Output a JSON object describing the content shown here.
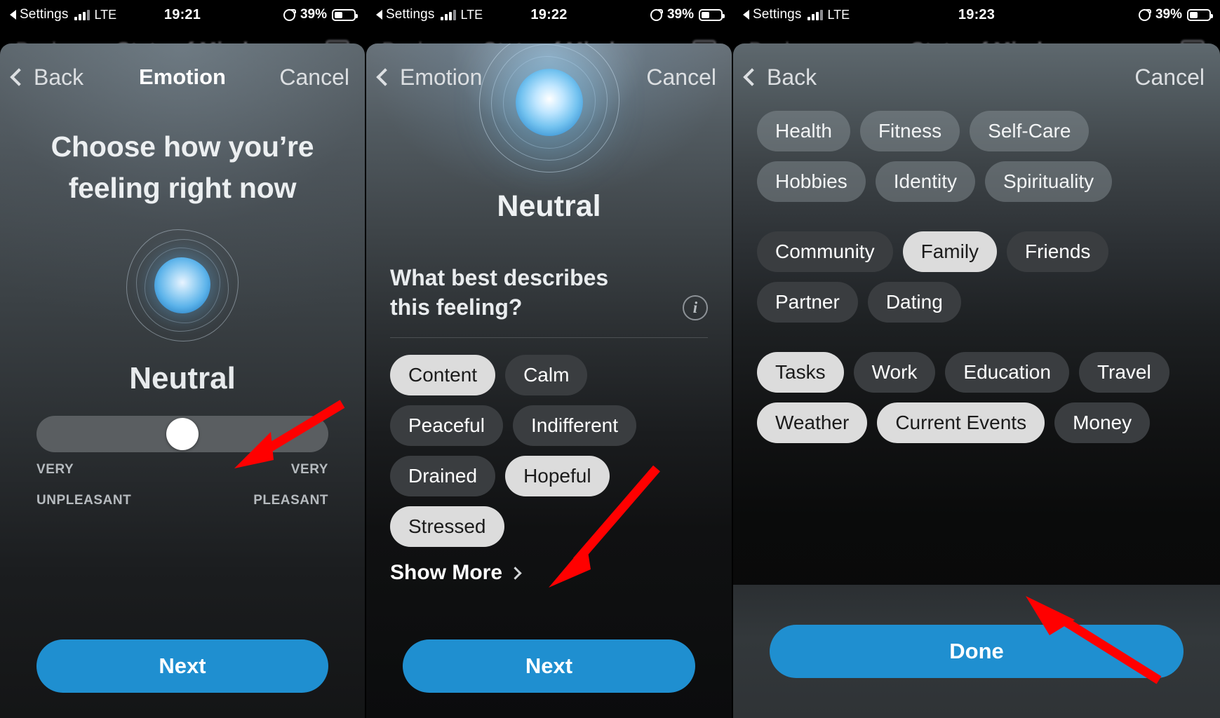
{
  "status_bars": [
    {
      "carrier": "Settings",
      "network": "LTE",
      "time": "19:21",
      "battery_pct": "39%"
    },
    {
      "carrier": "Settings",
      "network": "LTE",
      "time": "19:22",
      "battery_pct": "39%"
    },
    {
      "carrier": "Settings",
      "network": "LTE",
      "time": "19:23",
      "battery_pct": "39%"
    }
  ],
  "underlying_screen": {
    "back_label": "Back",
    "title": "State of Mind"
  },
  "panel1": {
    "nav": {
      "back_label": "Back",
      "title": "Emotion",
      "cancel_label": "Cancel"
    },
    "heading": "Choose how you’re feeling right now",
    "emotion": "Neutral",
    "slider": {
      "left_label_line1": "VERY",
      "left_label_line2": "UNPLEASANT",
      "right_label_line1": "VERY",
      "right_label_line2": "PLEASANT",
      "value_pct": 50
    },
    "cta_label": "Next"
  },
  "panel2": {
    "nav": {
      "back_label": "Emotion",
      "title": "",
      "cancel_label": "Cancel"
    },
    "emotion": "Neutral",
    "question_line1": "What best describes",
    "question_line2": "this feeling?",
    "info_icon": "info-icon",
    "chips": [
      {
        "label": "Content",
        "selected": true
      },
      {
        "label": "Calm",
        "selected": false
      },
      {
        "label": "Peaceful",
        "selected": false
      },
      {
        "label": "Indifferent",
        "selected": false
      },
      {
        "label": "Drained",
        "selected": false
      },
      {
        "label": "Hopeful",
        "selected": true
      },
      {
        "label": "Stressed",
        "selected": true
      }
    ],
    "show_more_label": "Show More",
    "cta_label": "Next"
  },
  "panel3": {
    "nav": {
      "back_label": "Back",
      "title": "",
      "cancel_label": "Cancel"
    },
    "groups": [
      {
        "name": "self",
        "chips": [
          {
            "label": "Health",
            "selected": false,
            "veiled": true
          },
          {
            "label": "Fitness",
            "selected": false,
            "veiled": true
          },
          {
            "label": "Self-Care",
            "selected": false,
            "veiled": true
          },
          {
            "label": "Hobbies",
            "selected": false,
            "veiled": true
          },
          {
            "label": "Identity",
            "selected": false,
            "veiled": true
          },
          {
            "label": "Spirituality",
            "selected": false,
            "veiled": true
          }
        ]
      },
      {
        "name": "relationships",
        "chips": [
          {
            "label": "Community",
            "selected": false,
            "veiled": false
          },
          {
            "label": "Family",
            "selected": true,
            "veiled": false
          },
          {
            "label": "Friends",
            "selected": false,
            "veiled": false
          },
          {
            "label": "Partner",
            "selected": false,
            "veiled": false
          },
          {
            "label": "Dating",
            "selected": false,
            "veiled": false
          }
        ]
      },
      {
        "name": "life",
        "chips": [
          {
            "label": "Tasks",
            "selected": true,
            "veiled": false
          },
          {
            "label": "Work",
            "selected": false,
            "veiled": false
          },
          {
            "label": "Education",
            "selected": false,
            "veiled": false
          },
          {
            "label": "Travel",
            "selected": false,
            "veiled": false
          },
          {
            "label": "Weather",
            "selected": true,
            "veiled": false
          },
          {
            "label": "Current Events",
            "selected": true,
            "veiled": false
          },
          {
            "label": "Money",
            "selected": false,
            "veiled": false
          }
        ]
      }
    ],
    "cta_label": "Done"
  },
  "annotations": {
    "color": "#FF0000",
    "arrows": [
      {
        "target": "slider-thumb",
        "panel": 1
      },
      {
        "target": "next-button",
        "panel": 2
      },
      {
        "target": "done-button",
        "panel": 3
      }
    ]
  }
}
